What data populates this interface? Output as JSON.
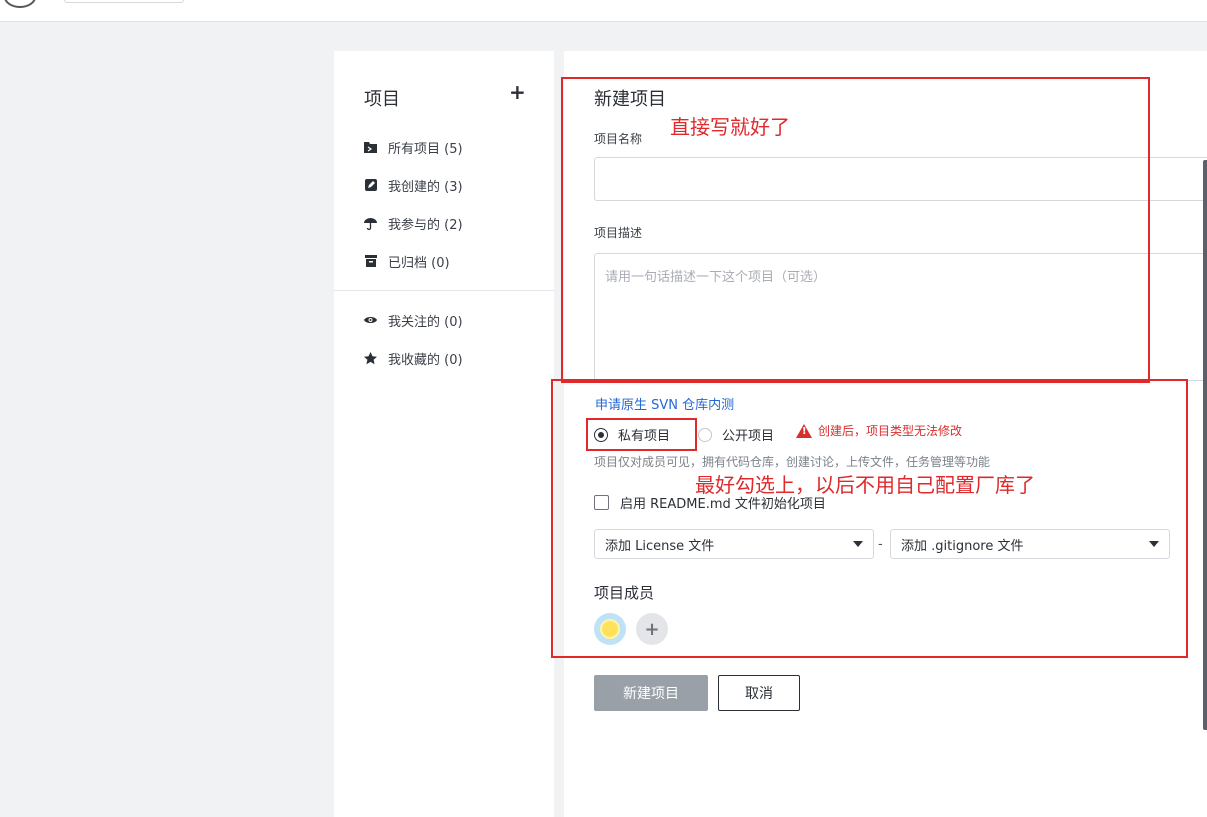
{
  "sidebar": {
    "title": "项目",
    "add_icon": "plus-icon",
    "items": [
      {
        "label": "所有项目 (5)",
        "icon": "folder-icon"
      },
      {
        "label": "我创建的 (3)",
        "icon": "edit-icon"
      },
      {
        "label": "我参与的 (2)",
        "icon": "umbrella-icon"
      },
      {
        "label": "已归档 (0)",
        "icon": "archive-icon"
      },
      {
        "label": "我关注的 (0)",
        "icon": "eye-icon"
      },
      {
        "label": "我收藏的 (0)",
        "icon": "star-icon"
      }
    ]
  },
  "form": {
    "title": "新建项目",
    "name_label": "项目名称",
    "name_value": "",
    "desc_label": "项目描述",
    "desc_placeholder": "请用一句话描述一下这个项目（可选）",
    "svn_link": "申请原生 SVN 仓库内测",
    "visibility": {
      "private_label": "私有项目",
      "public_label": "公开项目",
      "selected": "private",
      "warning": "创建后，项目类型无法修改"
    },
    "hint": "项目仅对成员可见，拥有代码仓库，创建讨论，上传文件，任务管理等功能",
    "readme_label": "启用 README.md 文件初始化项目",
    "readme_checked": false,
    "license_select": "添加 License 文件",
    "separator": "-",
    "gitignore_select": "添加 .gitignore 文件",
    "members_title": "项目成员",
    "submit_label": "新建项目",
    "cancel_label": "取消"
  },
  "annotations": {
    "note1": "直接写就好了",
    "note2": "最好勾选上，以后不用自己配置厂库了",
    "color": "#e0292b"
  },
  "colors": {
    "link": "#2368d6",
    "warning": "#d6302e",
    "primary_disabled": "#9aa0a8"
  }
}
